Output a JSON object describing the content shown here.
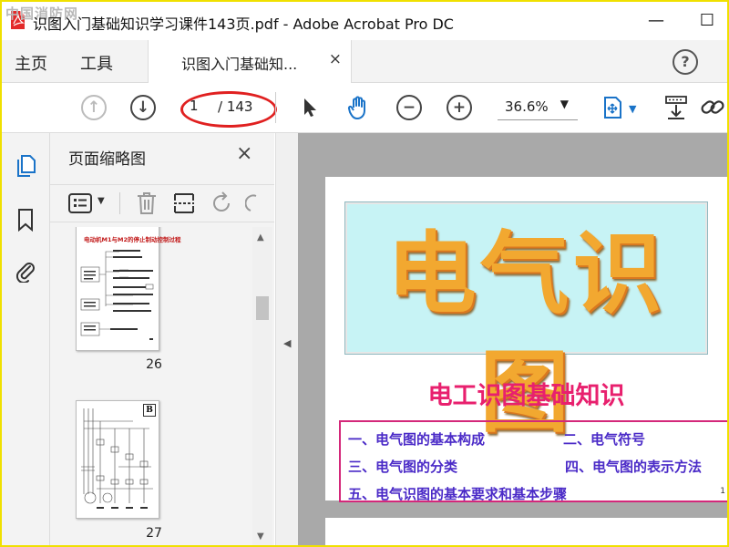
{
  "window": {
    "watermark": "中国消防网",
    "title": "识图入门基础知识学习课件143页.pdf - Adobe Acrobat Pro DC",
    "minimize": "—",
    "maximize": "☐"
  },
  "menubar": {
    "home": "主页",
    "tools": "工具"
  },
  "tab": {
    "label": "识图入门基础知...",
    "close": "×"
  },
  "help": "?",
  "toolbar": {
    "page_current": "1",
    "page_total": "/ 143",
    "zoom": "36.6%"
  },
  "panel": {
    "title": "页面缩略图",
    "close": "×",
    "thumbnails": [
      {
        "page": "26",
        "heading": "电动机M1与M2的停止制动控制过程"
      },
      {
        "page": "27",
        "badge": "B"
      }
    ]
  },
  "document": {
    "big_title": "电气识图",
    "subtitle": "电工识图基础知识",
    "toc": [
      "一、电气图的基本构成",
      "二、电气符号",
      "三、电气图的分类",
      "四、电气图的表示方法",
      "五、电气识图的基本要求和基本步骤"
    ],
    "edge_page_num": "1"
  },
  "colors": {
    "highlight_oval": "#e02020",
    "title_fill": "#f2a830",
    "subtitle": "#e8206e",
    "toc_text": "#4a2ac7",
    "toc_border": "#d4287a",
    "title_box_bg": "#c7f3f5"
  }
}
